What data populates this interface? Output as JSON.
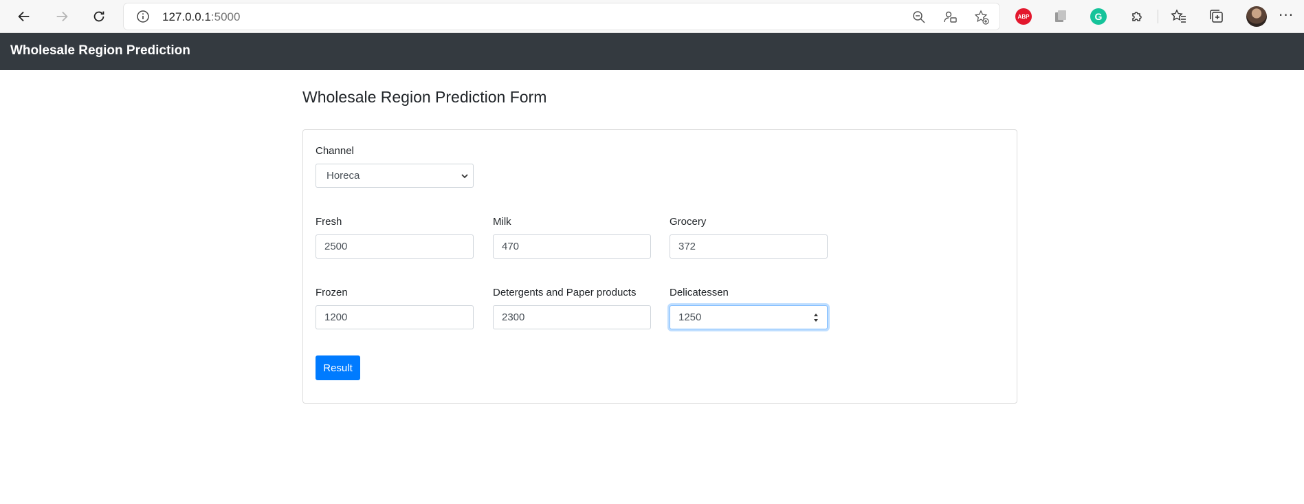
{
  "browser": {
    "url_host": "127.0.0.1",
    "url_port": ":5000",
    "ext_abp_label": "ABP",
    "ext_grammarly_label": "G",
    "more_label": "···"
  },
  "navbar": {
    "brand": "Wholesale Region Prediction"
  },
  "form": {
    "title": "Wholesale Region Prediction Form",
    "channel": {
      "label": "Channel",
      "value": "Horeca"
    },
    "fresh": {
      "label": "Fresh",
      "value": "2500"
    },
    "milk": {
      "label": "Milk",
      "value": "470"
    },
    "grocery": {
      "label": "Grocery",
      "value": "372"
    },
    "frozen": {
      "label": "Frozen",
      "value": "1200"
    },
    "detergents": {
      "label": "Detergents and Paper products",
      "value": "2300"
    },
    "delicatessen": {
      "label": "Delicatessen",
      "value": "1250"
    },
    "submit_label": "Result"
  },
  "colors": {
    "navbar_bg": "#343a40",
    "primary": "#007bff"
  }
}
